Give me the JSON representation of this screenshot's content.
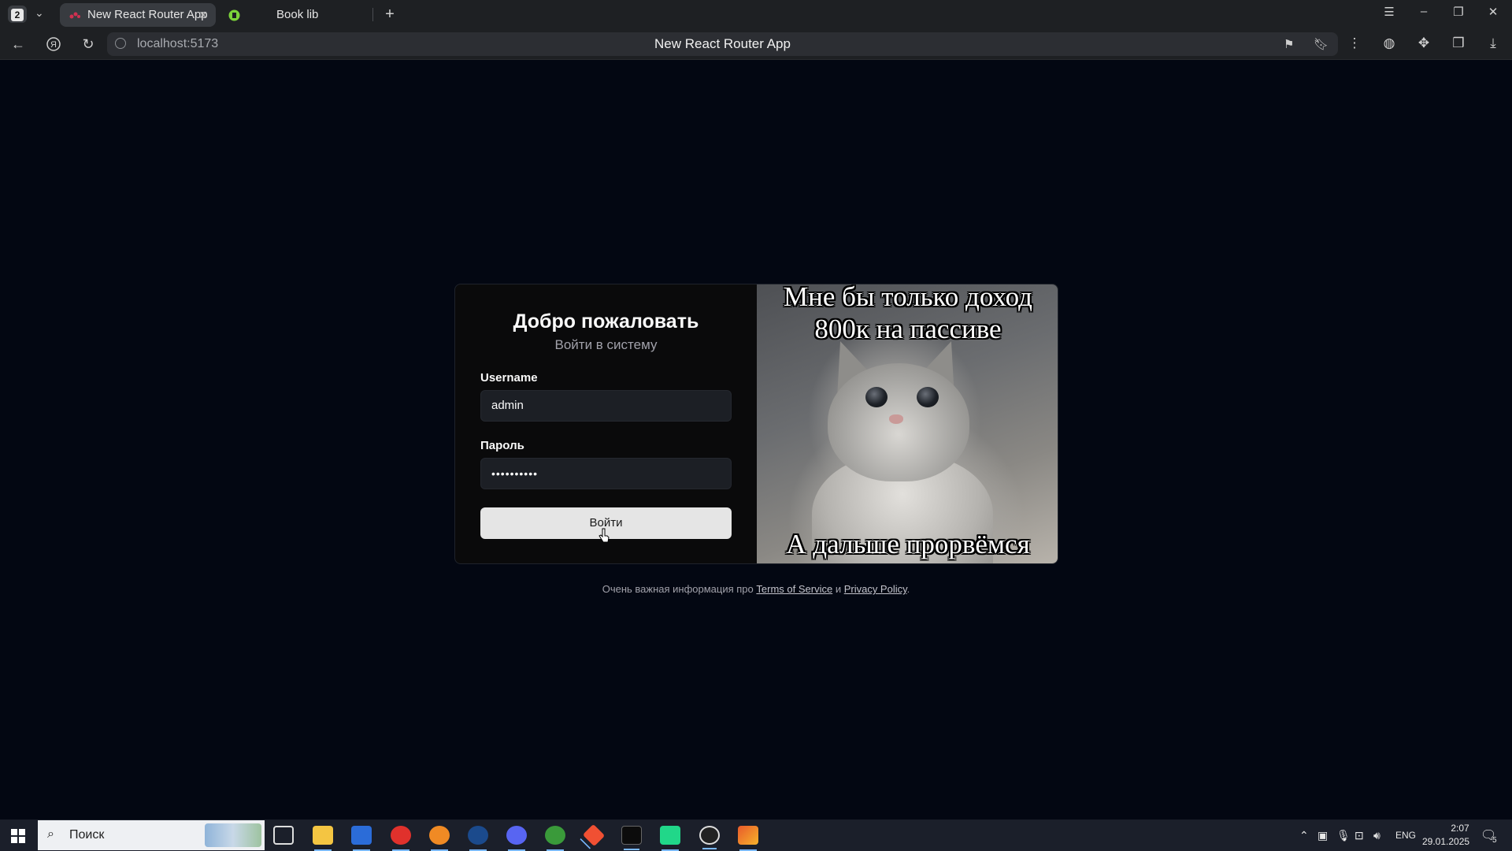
{
  "browser": {
    "tab_count": "2",
    "tabs": [
      {
        "title": "New React Router App",
        "active": true
      },
      {
        "title": "Book lib",
        "active": false
      }
    ],
    "url": "localhost:5173",
    "page_title": "New React Router App"
  },
  "login": {
    "title": "Добро пожаловать",
    "subtitle": "Войти в систему",
    "username_label": "Username",
    "username_value": "admin",
    "password_label": "Пароль",
    "password_value": "••••••••••",
    "submit_label": "Войти"
  },
  "meme": {
    "top_text_line1": "Мне бы только доход",
    "top_text_line2": "800к на пассиве",
    "bottom_text": "А дальше прорвёмся"
  },
  "footer": {
    "prefix": "Очень важная информация про ",
    "terms_link": "Terms of Service",
    "conjunction": " и ",
    "privacy_link": "Privacy Policy",
    "suffix": "."
  },
  "taskbar": {
    "search_placeholder": "Поиск",
    "language": "ENG",
    "time": "2:07",
    "date": "29.01.2025",
    "notification_count": "5"
  },
  "colors": {
    "page_background": "#030712",
    "card_background": "#0a0a0b",
    "button_background": "#e5e5e5"
  }
}
